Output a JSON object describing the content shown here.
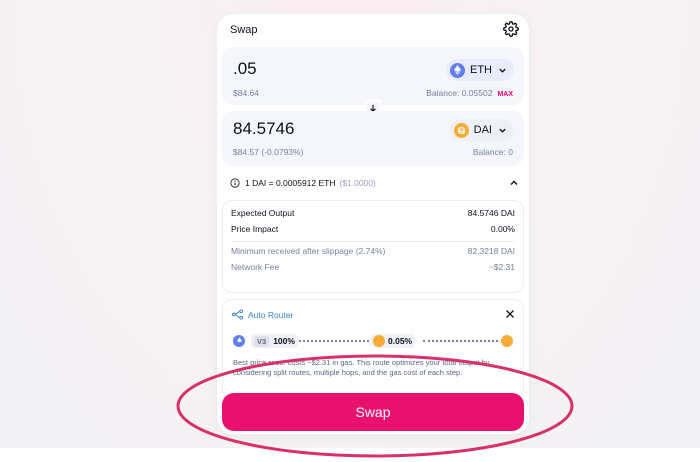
{
  "header": {
    "title": "Swap",
    "settings_icon": "gear-icon"
  },
  "input": {
    "amount": ".05",
    "usd_value": "$84.64",
    "token": "ETH",
    "balance": "Balance: 0.05502",
    "max_label": "MAX"
  },
  "output": {
    "amount": "84.5746",
    "usd_value": "$84.57 (-0.0793%)",
    "token": "DAI",
    "balance": "Balance: 0"
  },
  "rate": {
    "main": "1 DAI = 0.0005912 ETH",
    "usd": "($1.0000)"
  },
  "details": {
    "rows": [
      {
        "label": "Expected Output",
        "value": "84.5746 DAI"
      },
      {
        "label": "Price Impact",
        "value": "0.00%"
      },
      {
        "label": "Minimum received after slippage (2.74%)",
        "value": "82.3218 DAI"
      },
      {
        "label": "Network Fee",
        "value": "~$2.31"
      }
    ]
  },
  "router": {
    "title": "Auto Router",
    "version": "V3",
    "split": "100%",
    "fee": "0.05%",
    "description": "Best price route costs ~$2.31 in gas. This route optimizes your total output by considering split routes, multiple hops, and the gas cost of each step."
  },
  "swap_button": {
    "label": "Swap"
  },
  "colors": {
    "accent": "#e8116f",
    "eth": "#627eea",
    "dai": "#f5ac37",
    "annotation": "#d8306a"
  }
}
